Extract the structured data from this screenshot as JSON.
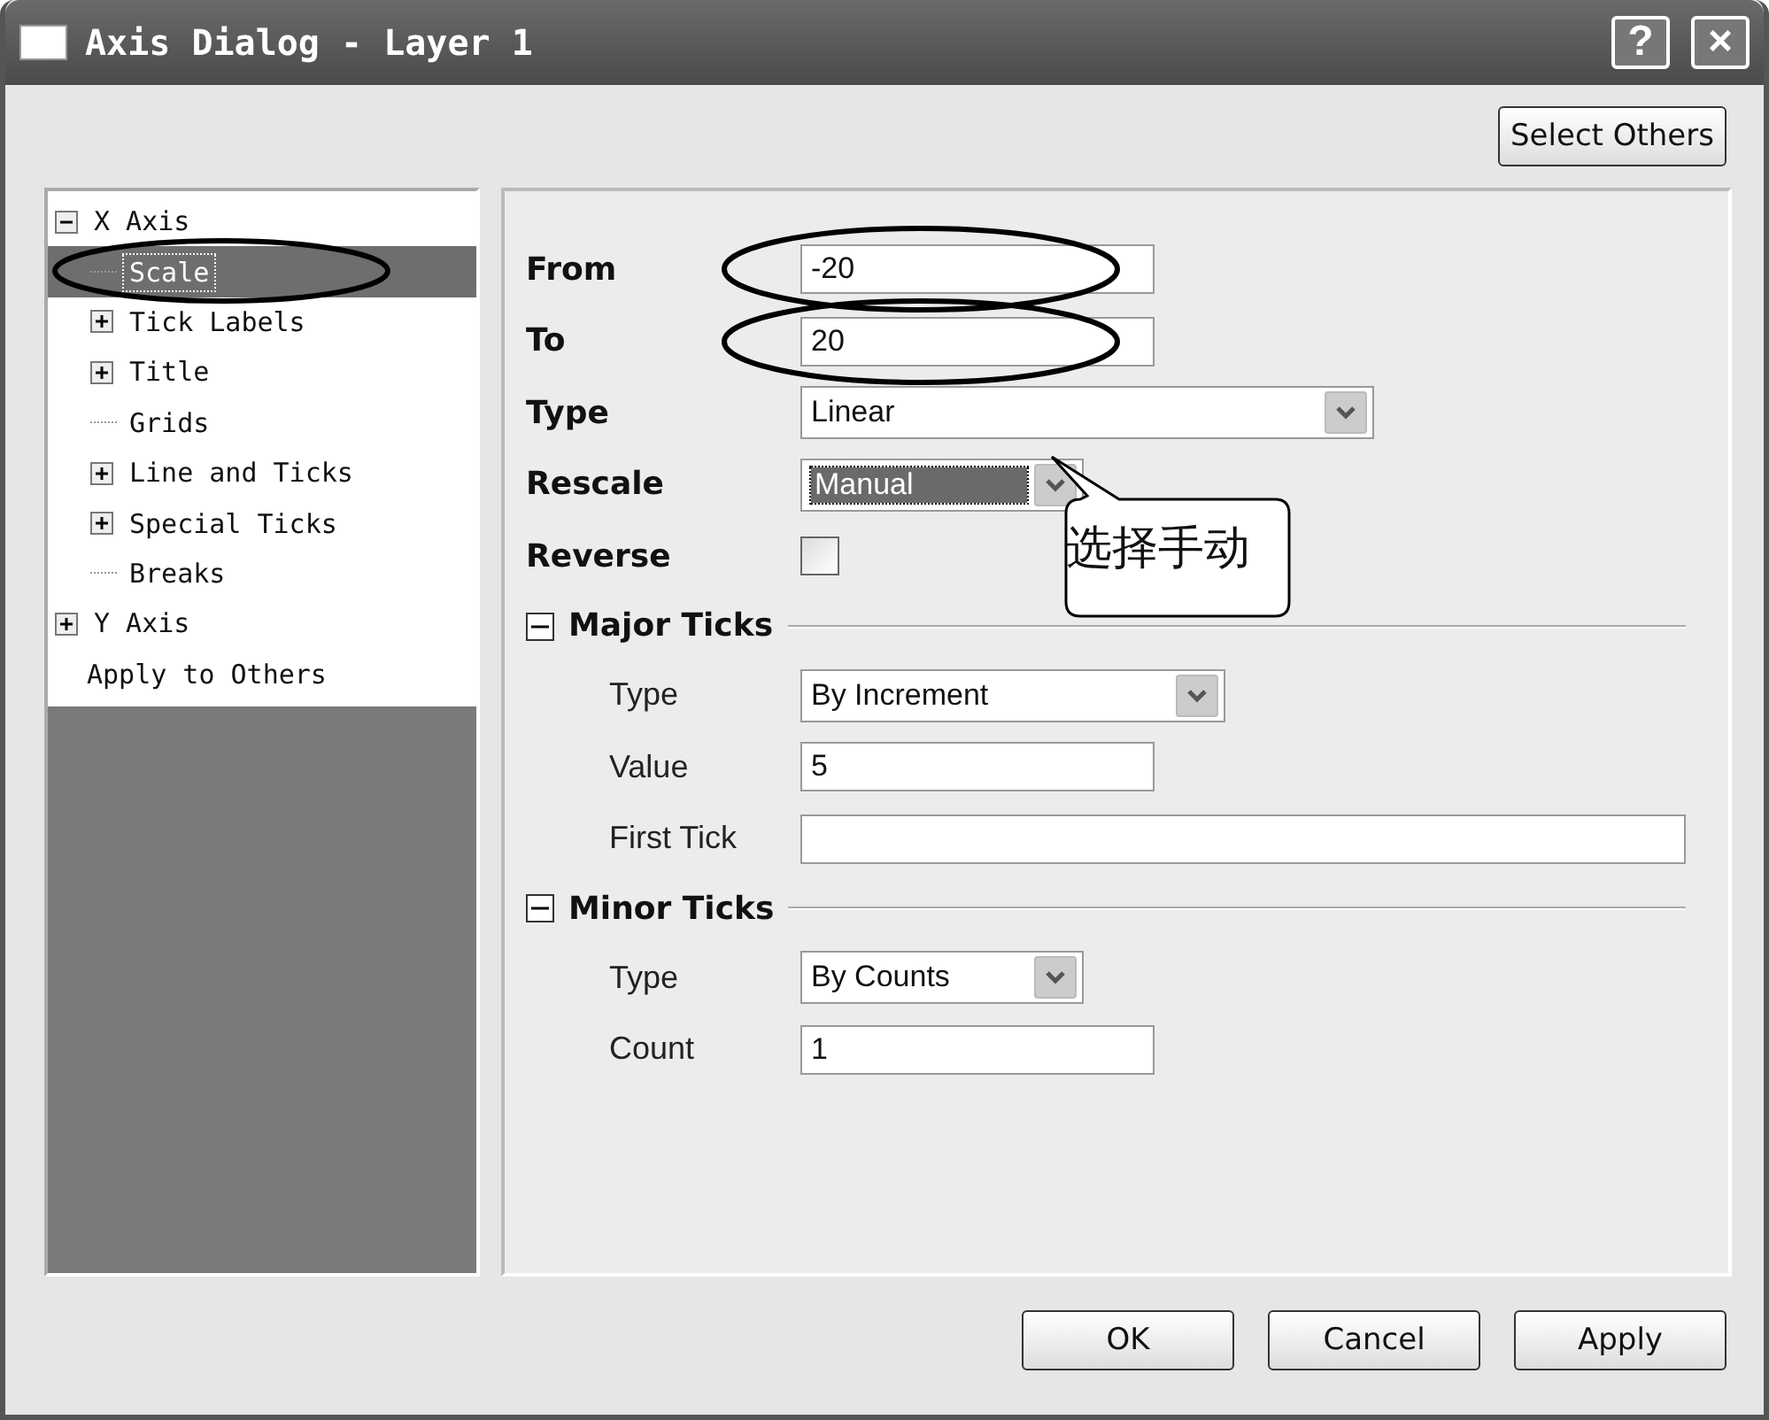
{
  "window": {
    "title": "Axis Dialog - Layer 1",
    "help": "?",
    "close": "×"
  },
  "top_button": "Select Others",
  "tree": [
    {
      "label": "X Axis",
      "expanded": true,
      "selected": false,
      "circled": false,
      "children": [
        {
          "label": "Scale",
          "selected": true,
          "circled": true
        },
        {
          "label": "Tick Labels",
          "expanded": false,
          "selected": false,
          "circled": false
        },
        {
          "label": "Title",
          "expanded": false,
          "selected": false,
          "circled": false
        },
        {
          "label": "Grids",
          "selected": false,
          "circled": false
        },
        {
          "label": "Line and Ticks",
          "expanded": false,
          "selected": false,
          "circled": false
        },
        {
          "label": "Special Ticks",
          "expanded": false,
          "selected": false,
          "circled": false
        },
        {
          "label": "Breaks",
          "selected": false,
          "circled": false
        }
      ]
    },
    {
      "label": "Y Axis",
      "expanded": false,
      "selected": false,
      "circled": false
    },
    {
      "label": "Apply to Others",
      "selected": false,
      "circled": false
    }
  ],
  "fields": [
    {
      "kind": "text",
      "label": "From",
      "value": "-20",
      "circled": true
    },
    {
      "kind": "text",
      "label": "To",
      "value": "20",
      "circled": true
    },
    {
      "kind": "dropdown",
      "label": "Type",
      "value": "Linear"
    },
    {
      "kind": "dropdown",
      "label": "Rescale",
      "value": "Manual",
      "focused": true,
      "callout": "选择手动"
    },
    {
      "kind": "checkbox",
      "label": "Reverse",
      "checked": false
    }
  ],
  "sections": [
    {
      "title": "Major Ticks",
      "expanded": true,
      "fields": [
        {
          "kind": "dropdown",
          "label": "Type",
          "value": "By Increment"
        },
        {
          "kind": "text",
          "label": "Value",
          "value": "5"
        },
        {
          "kind": "text",
          "label": "First Tick"
        }
      ]
    },
    {
      "title": "Minor Ticks",
      "expanded": true,
      "fields": [
        {
          "kind": "dropdown",
          "label": "Type",
          "value": "By Counts"
        },
        {
          "kind": "text",
          "label": "Count",
          "value": "1"
        }
      ]
    }
  ],
  "buttons": [
    "OK",
    "Cancel",
    "Apply"
  ]
}
